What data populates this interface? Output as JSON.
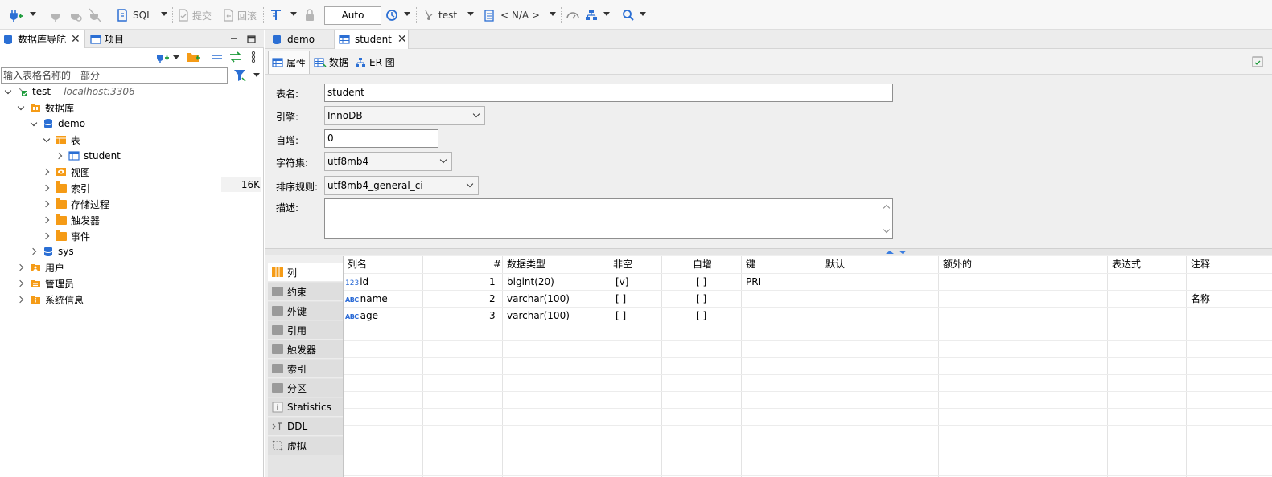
{
  "toolbar": {
    "sql_label": "SQL",
    "commit_label": "提交",
    "rollback_label": "回滚",
    "transaction_mode": "Auto",
    "datasource_label": "test",
    "schema_label": "< N/A >"
  },
  "navigator": {
    "tabs": [
      {
        "label": "数据库导航"
      },
      {
        "label": "项目"
      }
    ],
    "filter_placeholder": "输入表格名称的一部分",
    "tree": {
      "connection": {
        "label": "test",
        "host": "- localhost:3306"
      },
      "databases_label": "数据库",
      "demo_label": "demo",
      "tables_label": "表",
      "student_label": "student",
      "student_size": "16K",
      "views_label": "视图",
      "indexes_label": "索引",
      "procedures_label": "存储过程",
      "triggers_label": "触发器",
      "events_label": "事件",
      "sys_label": "sys",
      "users_label": "用户",
      "admins_label": "管理员",
      "sysinfo_label": "系统信息"
    }
  },
  "editor": {
    "tabs": [
      {
        "label": "demo"
      },
      {
        "label": "student"
      }
    ],
    "subtabs": [
      {
        "label": "属性"
      },
      {
        "label": "数据"
      },
      {
        "label": "ER 图"
      }
    ],
    "form": {
      "table_name_label": "表名:",
      "table_name": "student",
      "engine_label": "引擎:",
      "engine": "InnoDB",
      "auto_inc_label": "自增:",
      "auto_inc": "0",
      "charset_label": "字符集:",
      "charset": "utf8mb4",
      "collation_label": "排序规则:",
      "collation": "utf8mb4_general_ci",
      "desc_label": "描述:"
    },
    "vtabs": [
      {
        "label": "列"
      },
      {
        "label": "约束"
      },
      {
        "label": "外键"
      },
      {
        "label": "引用"
      },
      {
        "label": "触发器"
      },
      {
        "label": "索引"
      },
      {
        "label": "分区"
      },
      {
        "label": "Statistics"
      },
      {
        "label": "DDL"
      },
      {
        "label": "虚拟"
      }
    ],
    "columns_table": {
      "headers": [
        "列名",
        "#",
        "数据类型",
        "非空",
        "自增",
        "键",
        "默认",
        "额外的",
        "表达式",
        "注释"
      ],
      "rows": [
        {
          "type_icon": "123",
          "name": "id",
          "num": "1",
          "dtype": "bigint(20)",
          "notnull": "[v]",
          "autoinc": "[ ]",
          "key": "PRI",
          "comment": ""
        },
        {
          "type_icon": "ABC",
          "name": "name",
          "num": "2",
          "dtype": "varchar(100)",
          "notnull": "[ ]",
          "autoinc": "[ ]",
          "key": "",
          "comment": "名称"
        },
        {
          "type_icon": "ABC",
          "name": "age",
          "num": "3",
          "dtype": "varchar(100)",
          "notnull": "[ ]",
          "autoinc": "[ ]",
          "key": "",
          "comment": ""
        }
      ]
    }
  }
}
